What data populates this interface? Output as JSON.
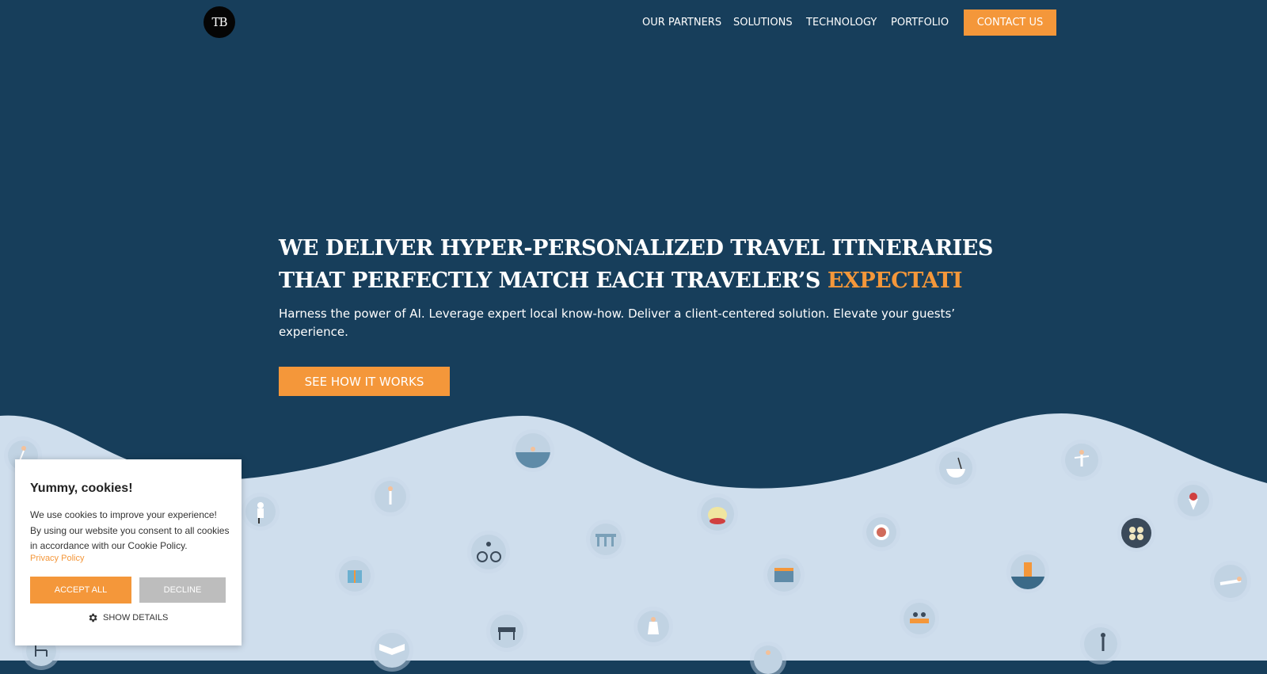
{
  "nav": {
    "logo_text": "TB",
    "links": [
      "OUR PARTNERS",
      "SOLUTIONS",
      "TECHNOLOGY",
      "PORTFOLIO"
    ],
    "contact": "CONTACT US"
  },
  "hero": {
    "headline_line1": "WE DELIVER HYPER-PERSONALIZED TRAVEL ITINERARIES",
    "headline_line2": "THAT PERFECTLY MATCH EACH TRAVELER’S",
    "headline_accent": "EXPECTATI",
    "subtitle": "Harness the power of AI. Leverage expert local know-how. Deliver a client-centered solution. Elevate your guests’ experience.",
    "cta": "SEE HOW IT WORKS"
  },
  "cookie": {
    "title": "Yummy, cookies!",
    "message": "We use cookies to improve your experience! By using our website you consent to all cookies in accordance with our Cookie Policy.",
    "policy_link": "Privacy Policy",
    "accept": "ACCEPT ALL",
    "decline": "DECLINE",
    "details": "SHOW DETAILS"
  },
  "colors": {
    "background": "#173e5b",
    "accent": "#f4973a",
    "wave": "#cfdeed"
  },
  "decor_icons": [
    "swimmer-icon",
    "yoga-icon",
    "chef-icon",
    "cyclist-icon",
    "gift-icon",
    "bridge-icon",
    "drink-icon",
    "museum-icon",
    "food-bowl-icon",
    "noodles-icon",
    "dancer-icon",
    "ice-cream-icon",
    "sushi-icon",
    "cocktail-icon",
    "sunbather-icon",
    "piano-icon",
    "tourist-icon",
    "picnic-icon",
    "musician-icon",
    "book-icon",
    "radio-icon",
    "chair-icon",
    "runner-icon"
  ]
}
